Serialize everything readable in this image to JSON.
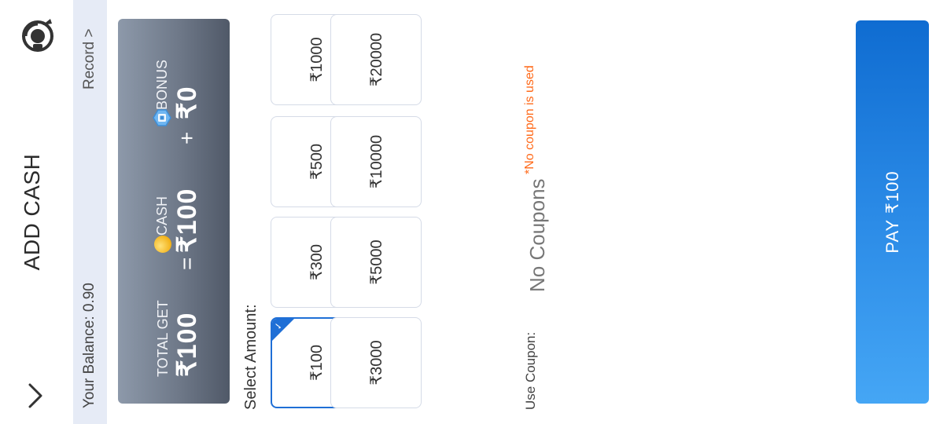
{
  "header": {
    "title": "ADD CASH",
    "back_icon": "chevron-down-icon",
    "support_icon": "headset-icon"
  },
  "balance": {
    "text": "Your Balance: 0.90",
    "record_link": "Record >"
  },
  "total_card": {
    "total_label": "TOTAL GET",
    "total_value": "₹100",
    "equals": "=",
    "cash_label": "CASH",
    "cash_value": "₹100",
    "plus": "+",
    "bonus_label": "BONUS",
    "bonus_value": "₹0"
  },
  "amounts": {
    "label": "Select Amount:",
    "options": [
      "₹100",
      "₹300",
      "₹500",
      "₹1000",
      "₹3000",
      "₹5000",
      "₹10000",
      "₹20000"
    ],
    "selected": "₹100"
  },
  "coupon": {
    "label": "Use Coupon:",
    "value": "No Coupons",
    "note": "*No coupon is used"
  },
  "pay_button": {
    "label": "PAY ₹100"
  },
  "colors": {
    "accent": "#1f6fd6",
    "balance_bar": "#e6ebf6",
    "note": "#ff6a1a",
    "pay_gradient_start": "#45a6f5",
    "pay_gradient_end": "#0f6cd1"
  }
}
